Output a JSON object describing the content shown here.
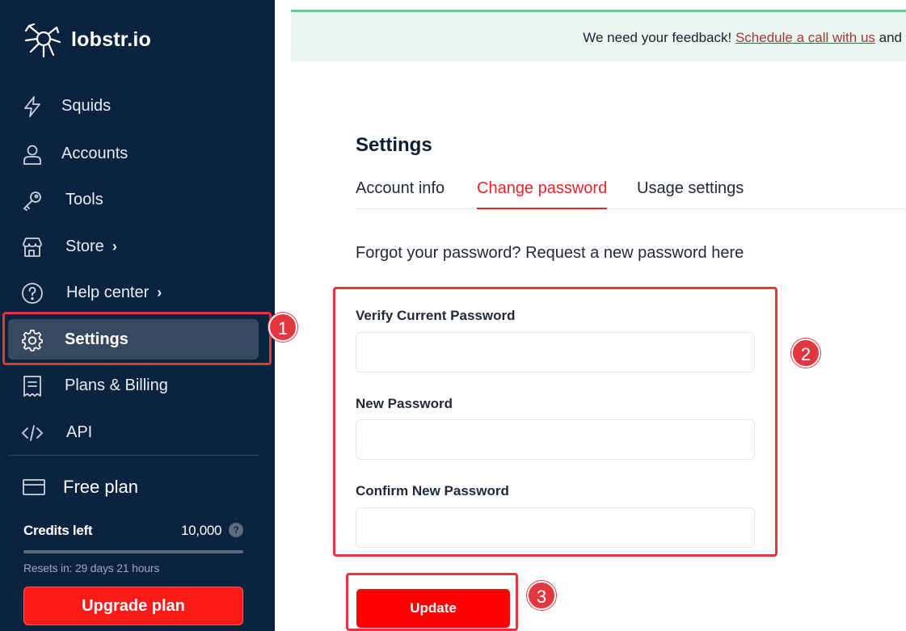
{
  "app": {
    "name": "lobstr.io"
  },
  "colors": {
    "sidebar_bg": "#0c2340",
    "accent_red": "#e8252a",
    "banner_bg": "#e8f6ef"
  },
  "sidebar": {
    "items": [
      {
        "label": "Squids",
        "icon": "lightning-icon"
      },
      {
        "label": "Accounts",
        "icon": "user-icon"
      },
      {
        "label": "Tools",
        "icon": "key-icon"
      },
      {
        "label": "Store",
        "icon": "store-icon",
        "chevron": "›"
      },
      {
        "label": "Help center",
        "icon": "help-circle-icon",
        "chevron": "›"
      },
      {
        "label": "Settings",
        "icon": "gear-icon",
        "active": true
      },
      {
        "label": "Plans & Billing",
        "icon": "receipt-icon"
      },
      {
        "label": "API",
        "icon": "code-icon"
      }
    ],
    "plan": {
      "name": "Free plan",
      "credits_label": "Credits left",
      "credits_value": "10,000",
      "credits_help": "?",
      "resets": "Resets in: 29 days 21 hours",
      "upgrade_label": "Upgrade plan"
    }
  },
  "banner": {
    "text": "We need your feedback! ",
    "link": "Schedule a call with us",
    "suffix": " and"
  },
  "settings": {
    "title": "Settings",
    "tabs": [
      {
        "label": "Account info"
      },
      {
        "label": "Change password",
        "active": true
      },
      {
        "label": "Usage settings"
      }
    ],
    "forgot_text": "Forgot your password? Request a new password here",
    "fields": [
      {
        "label": "Verify Current Password",
        "value": ""
      },
      {
        "label": "New Password",
        "value": ""
      },
      {
        "label": "Confirm New Password",
        "value": ""
      }
    ],
    "update_label": "Update"
  },
  "annotations": {
    "markers": [
      "1",
      "2",
      "3"
    ]
  }
}
